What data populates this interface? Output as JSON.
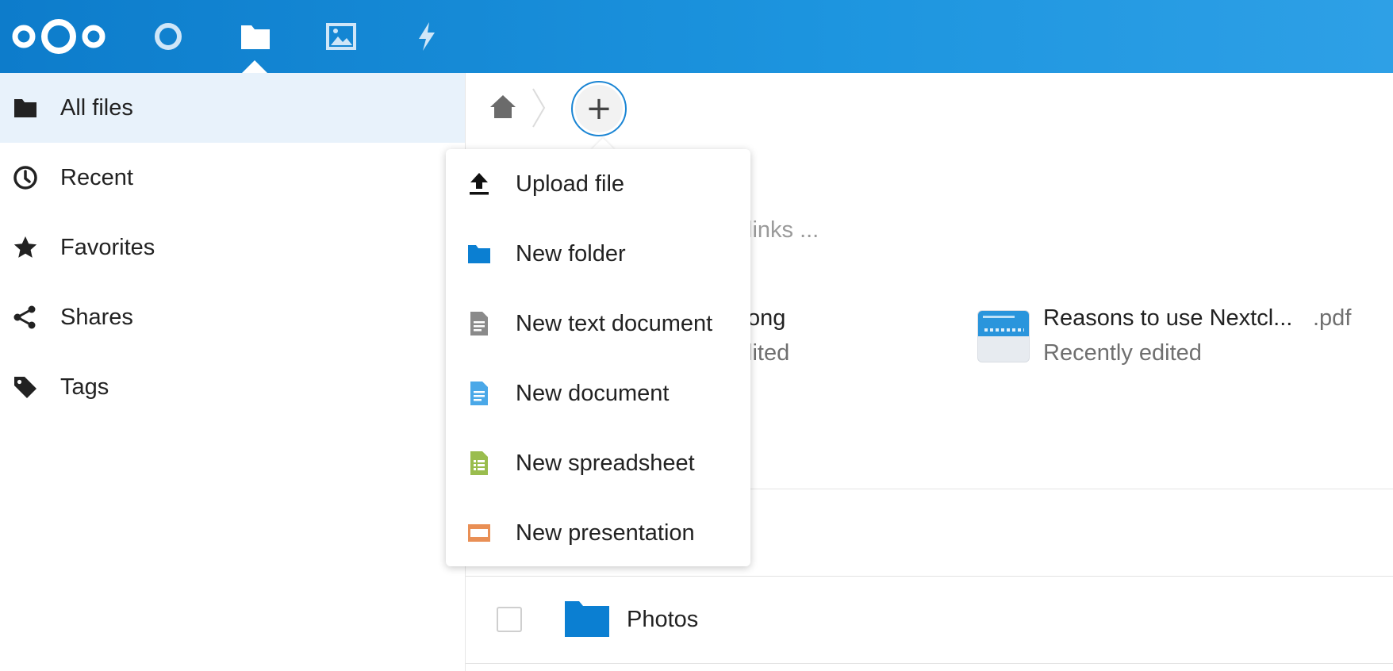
{
  "header": {
    "apps": [
      {
        "name": "dashboard",
        "icon": "circle-icon"
      },
      {
        "name": "files",
        "icon": "folder-icon",
        "active": true
      },
      {
        "name": "photos",
        "icon": "image-icon"
      },
      {
        "name": "activity",
        "icon": "lightning-icon"
      }
    ]
  },
  "sidebar": {
    "items": [
      {
        "label": "All files",
        "icon": "folder-icon",
        "active": true
      },
      {
        "label": "Recent",
        "icon": "clock-icon"
      },
      {
        "label": "Favorites",
        "icon": "star-icon"
      },
      {
        "label": "Shares",
        "icon": "share-icon"
      },
      {
        "label": "Tags",
        "icon": "tag-icon"
      }
    ]
  },
  "main": {
    "breadcrumb": {
      "home_icon": "home-icon",
      "new_button_label": "+"
    },
    "partial_links_text": "links ...",
    "recent_items": [
      {
        "name_fragment": "ong",
        "sub_fragment": "lited"
      },
      {
        "name": "Reasons to use Nextcl...",
        "ext": ".pdf",
        "sub": "Recently edited"
      }
    ],
    "file_rows": [
      {
        "name": "Photos",
        "icon": "folder-icon"
      }
    ]
  },
  "new_menu": {
    "items": [
      {
        "label": "Upload file",
        "icon": "upload-icon"
      },
      {
        "label": "New folder",
        "icon": "folder-icon"
      },
      {
        "label": "New text document",
        "icon": "text-document-icon"
      },
      {
        "label": "New document",
        "icon": "document-icon"
      },
      {
        "label": "New spreadsheet",
        "icon": "spreadsheet-icon"
      },
      {
        "label": "New presentation",
        "icon": "presentation-icon"
      }
    ]
  },
  "colors": {
    "brand": "#0082c9",
    "folder_blue": "#0b7fd2",
    "active_nav_bg": "#e8f2fb",
    "spreadsheet_green": "#9abd4e",
    "presentation_orange": "#e98f55",
    "document_blue": "#4aa8e8"
  }
}
